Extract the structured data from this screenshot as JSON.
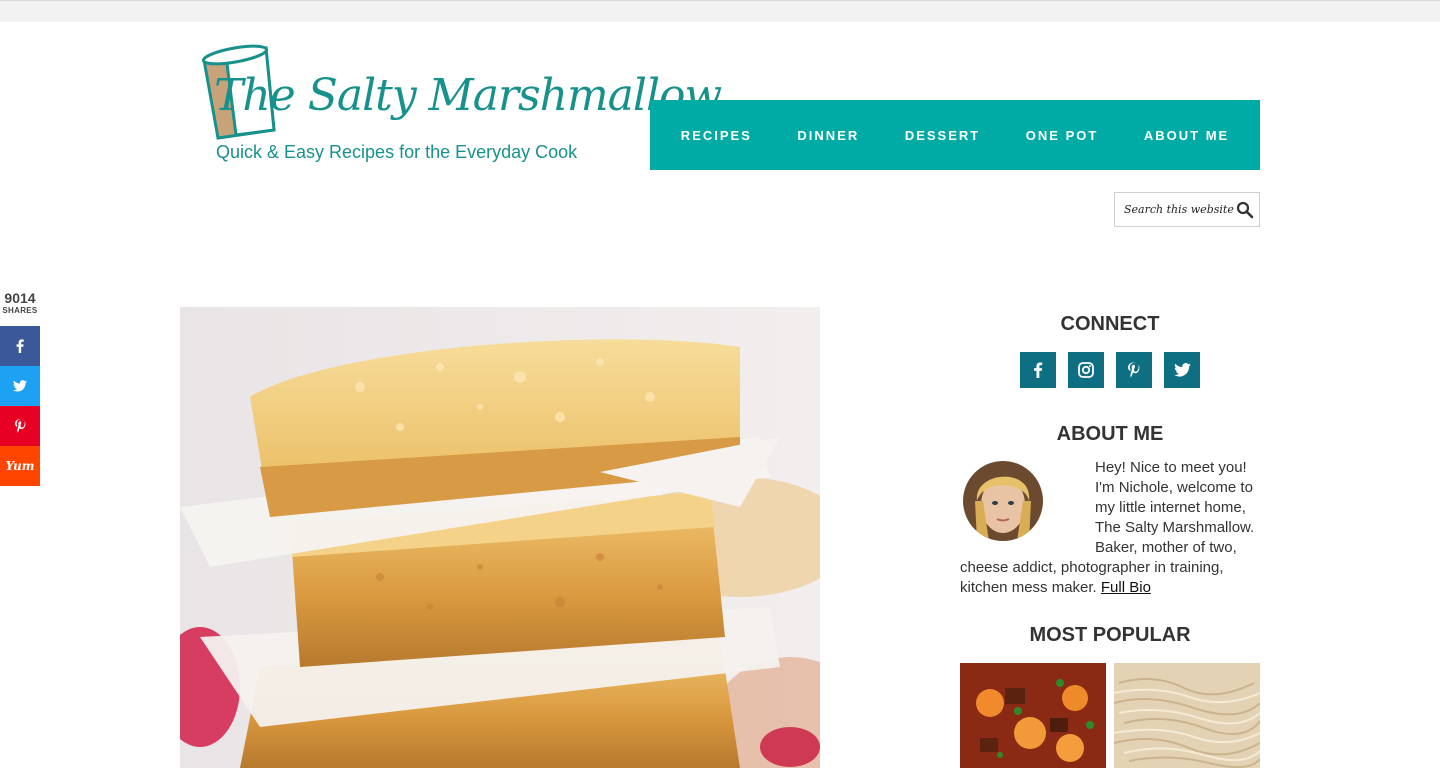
{
  "logo": {
    "title": "The Salty Marshmallow",
    "tagline": "Quick & Easy Recipes for the Everyday Cook"
  },
  "nav": {
    "items": [
      {
        "label": "RECIPES"
      },
      {
        "label": "DINNER"
      },
      {
        "label": "DESSERT"
      },
      {
        "label": "ONE POT"
      },
      {
        "label": "ABOUT ME"
      }
    ]
  },
  "search": {
    "placeholder": "Search this website",
    "icon": "search-icon"
  },
  "share": {
    "count": "9014",
    "label": "SHARES",
    "yum_label": "Yum",
    "buttons": [
      "facebook-icon",
      "twitter-icon",
      "pinterest-icon",
      "yummly-icon"
    ]
  },
  "sidebar": {
    "connect_heading": "CONNECT",
    "social_icons": [
      "facebook-icon",
      "instagram-icon",
      "pinterest-icon",
      "twitter-icon"
    ],
    "about_heading": "ABOUT ME",
    "about_text": "Hey! Nice to meet you! I'm Nichole, welcome to my little internet home, The Salty Marshmallow. Baker, mother of two, cheese addict, photographer in training, kitchen mess maker.",
    "about_link": "Full Bio",
    "popular_heading": "MOST POPULAR"
  },
  "colors": {
    "teal_nav": "#00aba5",
    "logo_teal": "#17918c",
    "social_teal": "#0e6f82",
    "facebook": "#3b5998",
    "twitter": "#1da1f2",
    "pinterest": "#e60023",
    "yummly": "#ff4500"
  }
}
